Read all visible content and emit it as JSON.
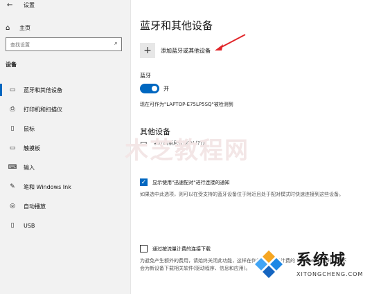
{
  "window": {
    "back_icon": "back-arrow-icon",
    "title": "设置"
  },
  "sidebar": {
    "home_label": "主页",
    "search_placeholder": "查找设置",
    "section_title": "设备",
    "items": [
      {
        "label": "蓝牙和其他设备",
        "icon": "bluetooth-devices-icon",
        "active": true
      },
      {
        "label": "打印机和扫描仪",
        "icon": "printer-icon",
        "active": false
      },
      {
        "label": "鼠标",
        "icon": "mouse-icon",
        "active": false
      },
      {
        "label": "触摸板",
        "icon": "touchpad-icon",
        "active": false
      },
      {
        "label": "输入",
        "icon": "keyboard-icon",
        "active": false
      },
      {
        "label": "笔和 Windows Ink",
        "icon": "pen-icon",
        "active": false
      },
      {
        "label": "自动播放",
        "icon": "autoplay-icon",
        "active": false
      },
      {
        "label": "USB",
        "icon": "usb-icon",
        "active": false
      }
    ]
  },
  "main": {
    "title": "蓝牙和其他设备",
    "add_button_label": "添加蓝牙或其他设备",
    "bluetooth_label": "蓝牙",
    "toggle_state": "开",
    "toggle_on": true,
    "discoverable_text": "现在可作为\"LAPTOP-E75LP5SQ\"被检测到",
    "other_devices_title": "其他设备",
    "devices": [
      {
        "name": "客厅的索尼智能TV (??)",
        "icon": "display-icon"
      }
    ],
    "swift_pair": {
      "checked": true,
      "label": "显示使用\"迅速配对\"进行连接的通知",
      "description": "如果选中此选项，则可以在受支持的蓝牙设备位于附近且处于配对模式时快速连接到这些设备。"
    },
    "metered": {
      "checked": false,
      "label": "通过按流量计费的连接下载",
      "description": "为避免产生额外的费用，请始终关闭此功能，这样在你使用按流量计费的 Internet 连接时，就不会为新设备下载相关软件(驱动程序、信息和应用)。"
    }
  },
  "watermark": {
    "text": "木芝教程网"
  },
  "logo": {
    "cn": "系统城",
    "en": "XITONGCHENG.COM"
  },
  "colors": {
    "accent": "#0067c0",
    "annotation_arrow": "#e1262a"
  }
}
